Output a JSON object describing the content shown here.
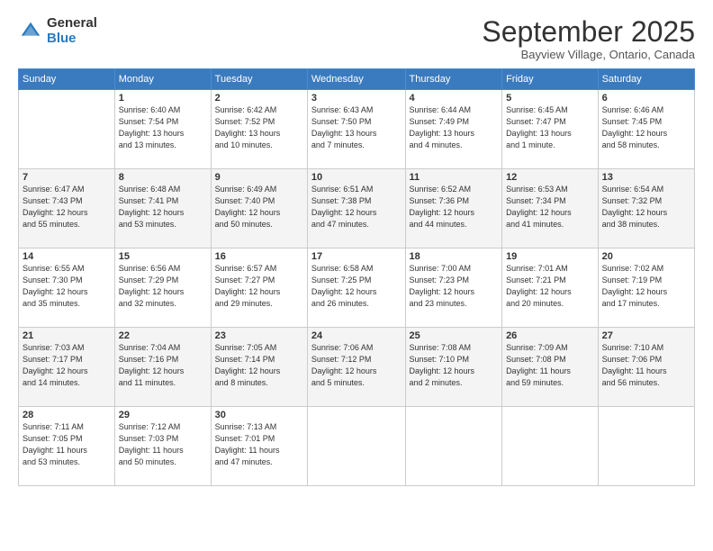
{
  "logo": {
    "general": "General",
    "blue": "Blue"
  },
  "title": "September 2025",
  "subtitle": "Bayview Village, Ontario, Canada",
  "days_of_week": [
    "Sunday",
    "Monday",
    "Tuesday",
    "Wednesday",
    "Thursday",
    "Friday",
    "Saturday"
  ],
  "weeks": [
    [
      {
        "day": "",
        "info": ""
      },
      {
        "day": "1",
        "info": "Sunrise: 6:40 AM\nSunset: 7:54 PM\nDaylight: 13 hours\nand 13 minutes."
      },
      {
        "day": "2",
        "info": "Sunrise: 6:42 AM\nSunset: 7:52 PM\nDaylight: 13 hours\nand 10 minutes."
      },
      {
        "day": "3",
        "info": "Sunrise: 6:43 AM\nSunset: 7:50 PM\nDaylight: 13 hours\nand 7 minutes."
      },
      {
        "day": "4",
        "info": "Sunrise: 6:44 AM\nSunset: 7:49 PM\nDaylight: 13 hours\nand 4 minutes."
      },
      {
        "day": "5",
        "info": "Sunrise: 6:45 AM\nSunset: 7:47 PM\nDaylight: 13 hours\nand 1 minute."
      },
      {
        "day": "6",
        "info": "Sunrise: 6:46 AM\nSunset: 7:45 PM\nDaylight: 12 hours\nand 58 minutes."
      }
    ],
    [
      {
        "day": "7",
        "info": "Sunrise: 6:47 AM\nSunset: 7:43 PM\nDaylight: 12 hours\nand 55 minutes."
      },
      {
        "day": "8",
        "info": "Sunrise: 6:48 AM\nSunset: 7:41 PM\nDaylight: 12 hours\nand 53 minutes."
      },
      {
        "day": "9",
        "info": "Sunrise: 6:49 AM\nSunset: 7:40 PM\nDaylight: 12 hours\nand 50 minutes."
      },
      {
        "day": "10",
        "info": "Sunrise: 6:51 AM\nSunset: 7:38 PM\nDaylight: 12 hours\nand 47 minutes."
      },
      {
        "day": "11",
        "info": "Sunrise: 6:52 AM\nSunset: 7:36 PM\nDaylight: 12 hours\nand 44 minutes."
      },
      {
        "day": "12",
        "info": "Sunrise: 6:53 AM\nSunset: 7:34 PM\nDaylight: 12 hours\nand 41 minutes."
      },
      {
        "day": "13",
        "info": "Sunrise: 6:54 AM\nSunset: 7:32 PM\nDaylight: 12 hours\nand 38 minutes."
      }
    ],
    [
      {
        "day": "14",
        "info": "Sunrise: 6:55 AM\nSunset: 7:30 PM\nDaylight: 12 hours\nand 35 minutes."
      },
      {
        "day": "15",
        "info": "Sunrise: 6:56 AM\nSunset: 7:29 PM\nDaylight: 12 hours\nand 32 minutes."
      },
      {
        "day": "16",
        "info": "Sunrise: 6:57 AM\nSunset: 7:27 PM\nDaylight: 12 hours\nand 29 minutes."
      },
      {
        "day": "17",
        "info": "Sunrise: 6:58 AM\nSunset: 7:25 PM\nDaylight: 12 hours\nand 26 minutes."
      },
      {
        "day": "18",
        "info": "Sunrise: 7:00 AM\nSunset: 7:23 PM\nDaylight: 12 hours\nand 23 minutes."
      },
      {
        "day": "19",
        "info": "Sunrise: 7:01 AM\nSunset: 7:21 PM\nDaylight: 12 hours\nand 20 minutes."
      },
      {
        "day": "20",
        "info": "Sunrise: 7:02 AM\nSunset: 7:19 PM\nDaylight: 12 hours\nand 17 minutes."
      }
    ],
    [
      {
        "day": "21",
        "info": "Sunrise: 7:03 AM\nSunset: 7:17 PM\nDaylight: 12 hours\nand 14 minutes."
      },
      {
        "day": "22",
        "info": "Sunrise: 7:04 AM\nSunset: 7:16 PM\nDaylight: 12 hours\nand 11 minutes."
      },
      {
        "day": "23",
        "info": "Sunrise: 7:05 AM\nSunset: 7:14 PM\nDaylight: 12 hours\nand 8 minutes."
      },
      {
        "day": "24",
        "info": "Sunrise: 7:06 AM\nSunset: 7:12 PM\nDaylight: 12 hours\nand 5 minutes."
      },
      {
        "day": "25",
        "info": "Sunrise: 7:08 AM\nSunset: 7:10 PM\nDaylight: 12 hours\nand 2 minutes."
      },
      {
        "day": "26",
        "info": "Sunrise: 7:09 AM\nSunset: 7:08 PM\nDaylight: 11 hours\nand 59 minutes."
      },
      {
        "day": "27",
        "info": "Sunrise: 7:10 AM\nSunset: 7:06 PM\nDaylight: 11 hours\nand 56 minutes."
      }
    ],
    [
      {
        "day": "28",
        "info": "Sunrise: 7:11 AM\nSunset: 7:05 PM\nDaylight: 11 hours\nand 53 minutes."
      },
      {
        "day": "29",
        "info": "Sunrise: 7:12 AM\nSunset: 7:03 PM\nDaylight: 11 hours\nand 50 minutes."
      },
      {
        "day": "30",
        "info": "Sunrise: 7:13 AM\nSunset: 7:01 PM\nDaylight: 11 hours\nand 47 minutes."
      },
      {
        "day": "",
        "info": ""
      },
      {
        "day": "",
        "info": ""
      },
      {
        "day": "",
        "info": ""
      },
      {
        "day": "",
        "info": ""
      }
    ]
  ]
}
